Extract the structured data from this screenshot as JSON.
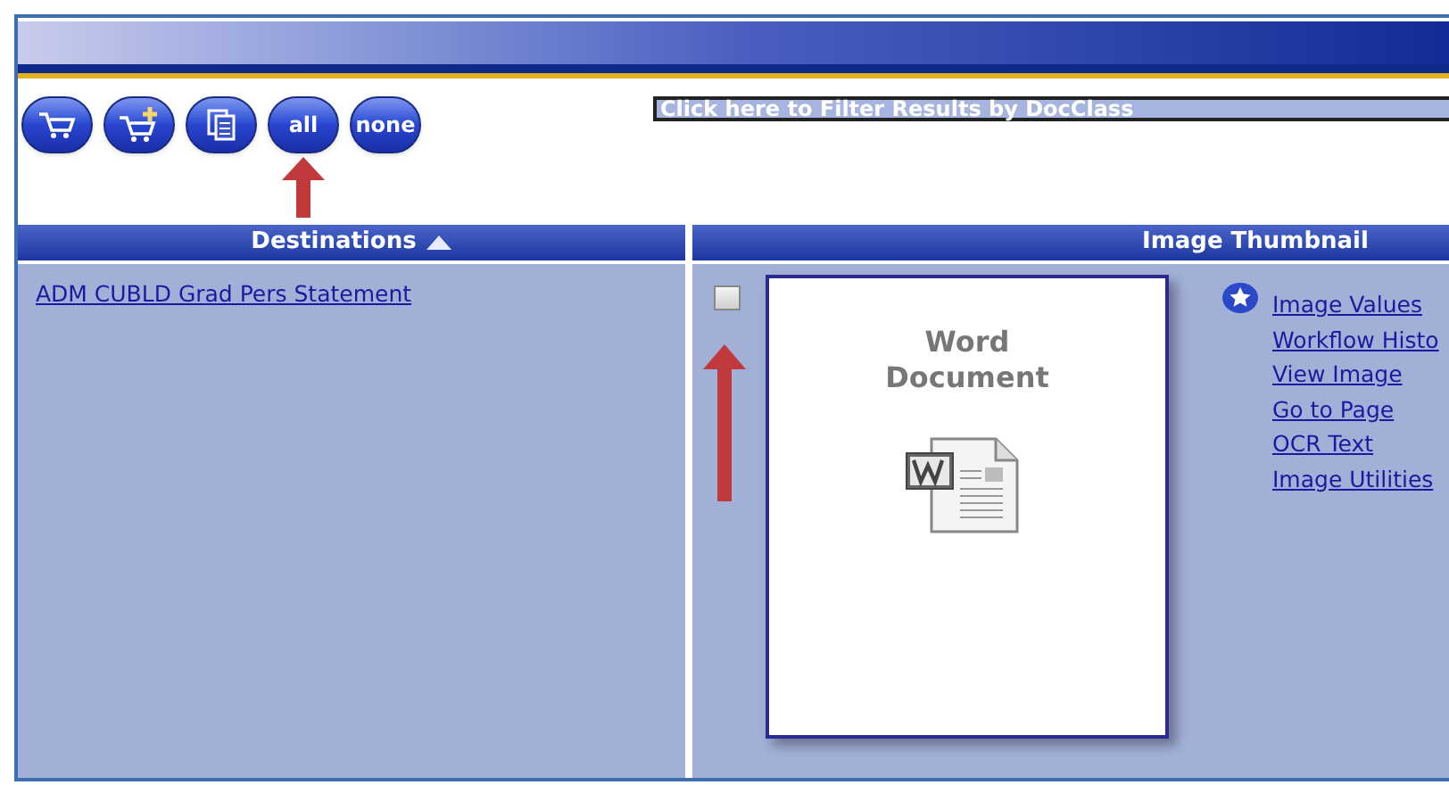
{
  "toolbar": {
    "buttons": [
      {
        "kind": "cart"
      },
      {
        "kind": "cart-add"
      },
      {
        "kind": "pages"
      },
      {
        "kind": "text",
        "label": "all"
      },
      {
        "kind": "text",
        "label": "none"
      }
    ],
    "filter": "Click here to Filter Results by DocClass"
  },
  "destinations": {
    "header": "Destinations",
    "items": [
      "ADM CUBLD Grad Pers Statement"
    ]
  },
  "thumbnail": {
    "header": "Image Thumbnail",
    "checked": false,
    "card_title": "Word Document",
    "links": [
      "Image Values",
      "Workflow Histo",
      "View Image",
      "Go to Page",
      "OCR Text",
      "Image Utilities"
    ]
  }
}
